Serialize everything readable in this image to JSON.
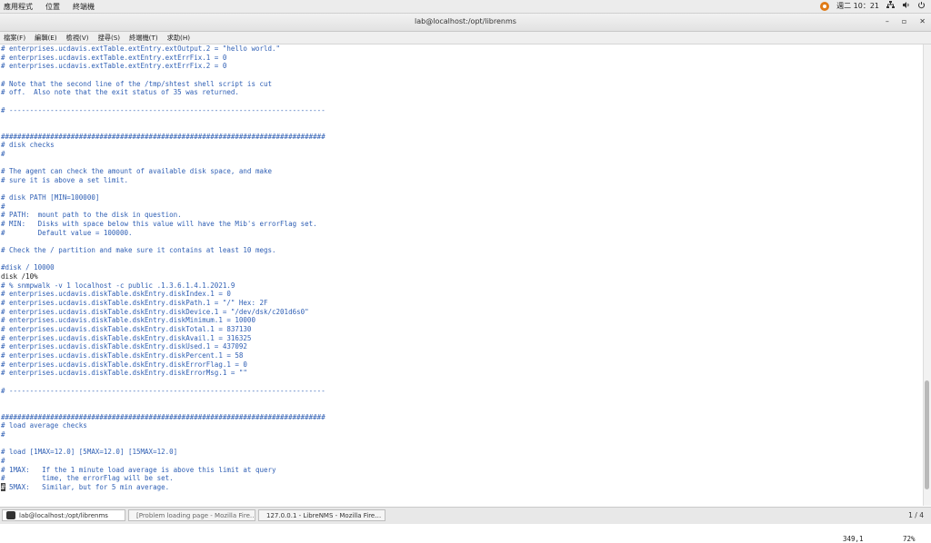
{
  "topbar": {
    "menu": [
      "應用程式",
      "位置",
      "終端機"
    ],
    "clock": "週二 10：21",
    "icons": [
      "ubuntu-logo",
      "network-icon",
      "volume-icon",
      "power-icon"
    ]
  },
  "window": {
    "title": "lab@localhost:/opt/librenms",
    "controls": [
      "–",
      "▫",
      "✕"
    ]
  },
  "menubar": [
    "檔案(F)",
    "編輯(E)",
    "檢視(V)",
    "搜尋(S)",
    "終端機(T)",
    "求助(H)"
  ],
  "lines": [
    "# enterprises.ucdavis.extTable.extEntry.extOutput.2 = \"hello world.\"",
    "# enterprises.ucdavis.extTable.extEntry.extErrFix.1 = 0",
    "# enterprises.ucdavis.extTable.extEntry.extErrFix.2 = 0",
    "",
    "# Note that the second line of the /tmp/shtest shell script is cut",
    "# off.  Also note that the exit status of 35 was returned.",
    "",
    "# -----------------------------------------------------------------------------",
    "",
    "",
    "###############################################################################",
    "# disk checks",
    "#",
    "",
    "# The agent can check the amount of available disk space, and make",
    "# sure it is above a set limit.",
    "",
    "# disk PATH [MIN=100000]",
    "#",
    "# PATH:  mount path to the disk in question.",
    "# MIN:   Disks with space below this value will have the Mib's errorFlag set.",
    "#        Default value = 100000.",
    "",
    "# Check the / partition and make sure it contains at least 10 megs.",
    "",
    "#disk / 10000",
    "disk /10%",
    "# % snmpwalk -v 1 localhost -c public .1.3.6.1.4.1.2021.9",
    "# enterprises.ucdavis.diskTable.dskEntry.diskIndex.1 = 0",
    "# enterprises.ucdavis.diskTable.dskEntry.diskPath.1 = \"/\" Hex: 2F",
    "# enterprises.ucdavis.diskTable.dskEntry.diskDevice.1 = \"/dev/dsk/c201d6s0\"",
    "# enterprises.ucdavis.diskTable.dskEntry.diskMinimum.1 = 10000",
    "# enterprises.ucdavis.diskTable.dskEntry.diskTotal.1 = 837130",
    "# enterprises.ucdavis.diskTable.dskEntry.diskAvail.1 = 316325",
    "# enterprises.ucdavis.diskTable.dskEntry.diskUsed.1 = 437092",
    "# enterprises.ucdavis.diskTable.dskEntry.diskPercent.1 = 58",
    "# enterprises.ucdavis.diskTable.dskEntry.diskErrorFlag.1 = 0",
    "# enterprises.ucdavis.diskTable.dskEntry.diskErrorMsg.1 = \"\"",
    "",
    "# -----------------------------------------------------------------------------",
    "",
    "",
    "###############################################################################",
    "# load average checks",
    "#",
    "",
    "# load [1MAX=12.0] [5MAX=12.0] [15MAX=12.0]",
    "#",
    "# 1MAX:   If the 1 minute load average is above this limit at query",
    "#         time, the errorFlag will be set.",
    "# 5MAX:   Similar, but for 5 min average."
  ],
  "status": {
    "position": "349,1",
    "percent": "72%"
  },
  "taskbar": {
    "items": [
      {
        "label": "lab@localhost:/opt/librenms",
        "icon": "terminal-icon"
      },
      {
        "label": "[Problem loading page - Mozilla Fire…",
        "icon": "firefox-icon"
      },
      {
        "label": "127.0.0.1 - LibreNMS - Mozilla Fire…",
        "icon": "firefox-icon"
      }
    ],
    "pager": "1 / 4"
  }
}
